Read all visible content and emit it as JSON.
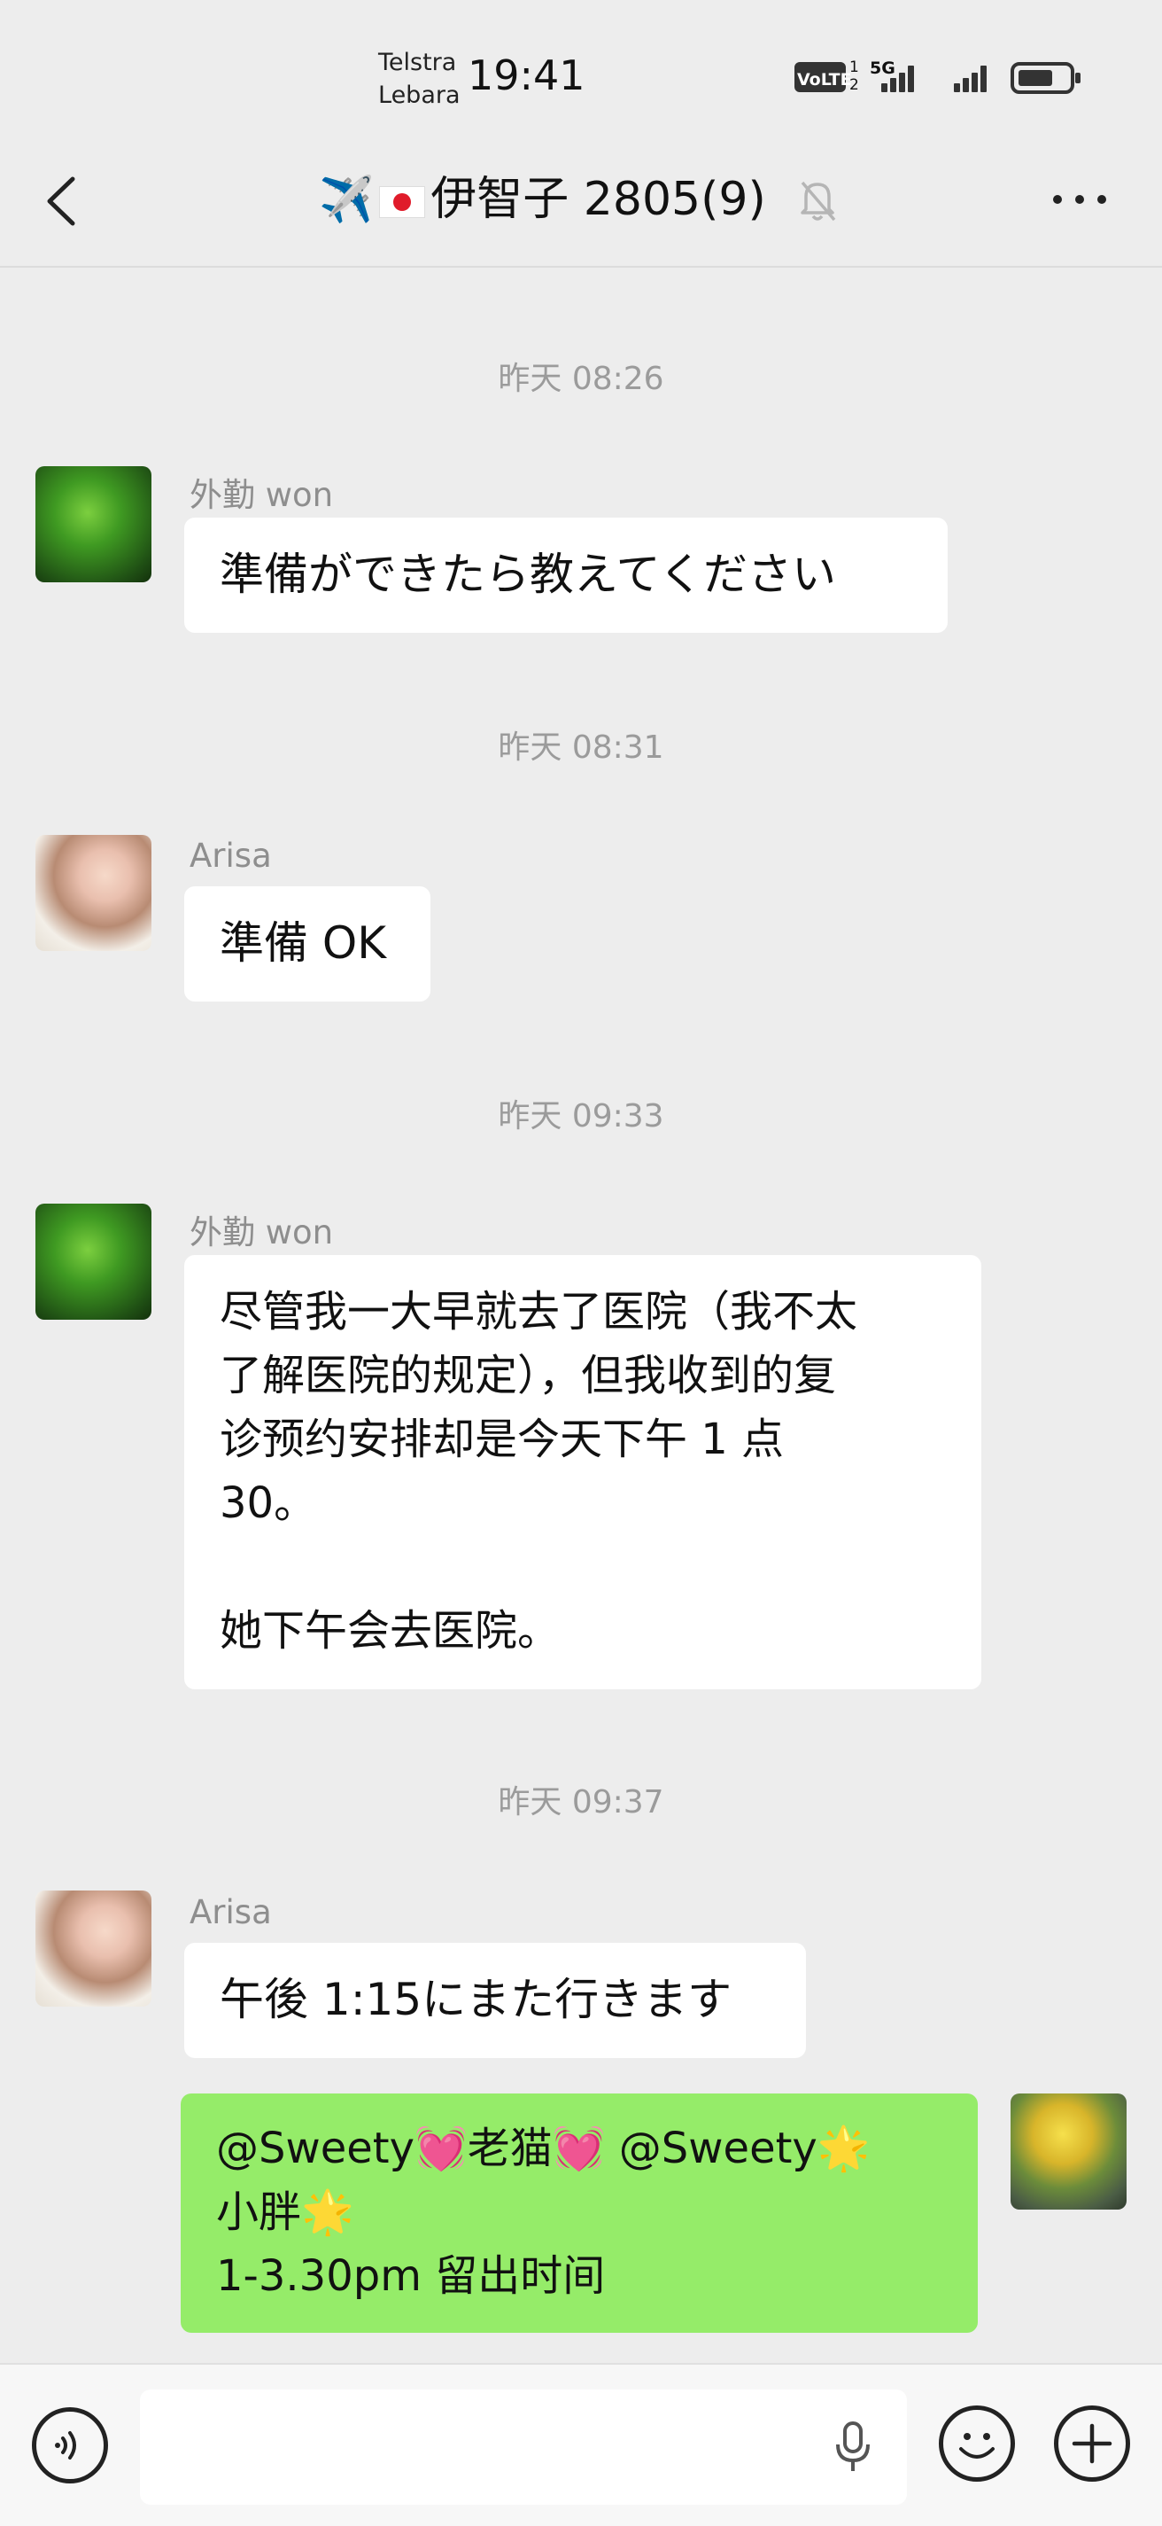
{
  "status_bar": {
    "carrier_1": "Telstra",
    "carrier_2": "Lebara",
    "time": "19:41",
    "volte": "VoLTE",
    "sim_label": "1 2",
    "network": "5G"
  },
  "header": {
    "title": "伊智子 2805(9)",
    "title_emoji": "✈️",
    "more_label": "..."
  },
  "messages": [
    {
      "type": "timestamp",
      "text": "昨天 08:26"
    },
    {
      "type": "incoming",
      "sender": "外勤 won",
      "avatar": "clover-avatar",
      "text": "準備ができたら教えてください"
    },
    {
      "type": "timestamp",
      "text": "昨天 08:31"
    },
    {
      "type": "incoming",
      "sender": "Arisa",
      "avatar": "woman-with-flowers-avatar",
      "text": "準備 OK"
    },
    {
      "type": "timestamp",
      "text": "昨天 09:33"
    },
    {
      "type": "incoming",
      "sender": "外勤 won",
      "avatar": "clover-avatar",
      "lines": [
        "尽管我一大早就去了医院（我不太",
        "了解医院的规定），但我收到的复",
        "诊预约安排却是今天下午 1 点",
        "30。",
        "",
        "她下午会去医院。"
      ]
    },
    {
      "type": "timestamp",
      "text": "昨天 09:37"
    },
    {
      "type": "incoming",
      "sender": "Arisa",
      "avatar": "woman-with-flowers-avatar",
      "text": "午後 1:15にまた行きます"
    },
    {
      "type": "outgoing",
      "avatar": "daffodils-avatar",
      "lines": [
        "@Sweety💓老猫💓 @Sweety🌟",
        "小胖🌟",
        "1-3.30pm 留出时间"
      ]
    }
  ],
  "input_bar": {
    "voice_icon": "voice-toggle-icon",
    "mic_icon": "microphone-icon",
    "emoji_icon": "emoji-icon",
    "plus_icon": "plus-icon"
  },
  "colors": {
    "background": "#ededed",
    "incoming_bubble": "#ffffff",
    "outgoing_bubble": "#95ec69",
    "timestamp_text": "#9b9b9b",
    "sender_text": "#8e8e8e"
  }
}
